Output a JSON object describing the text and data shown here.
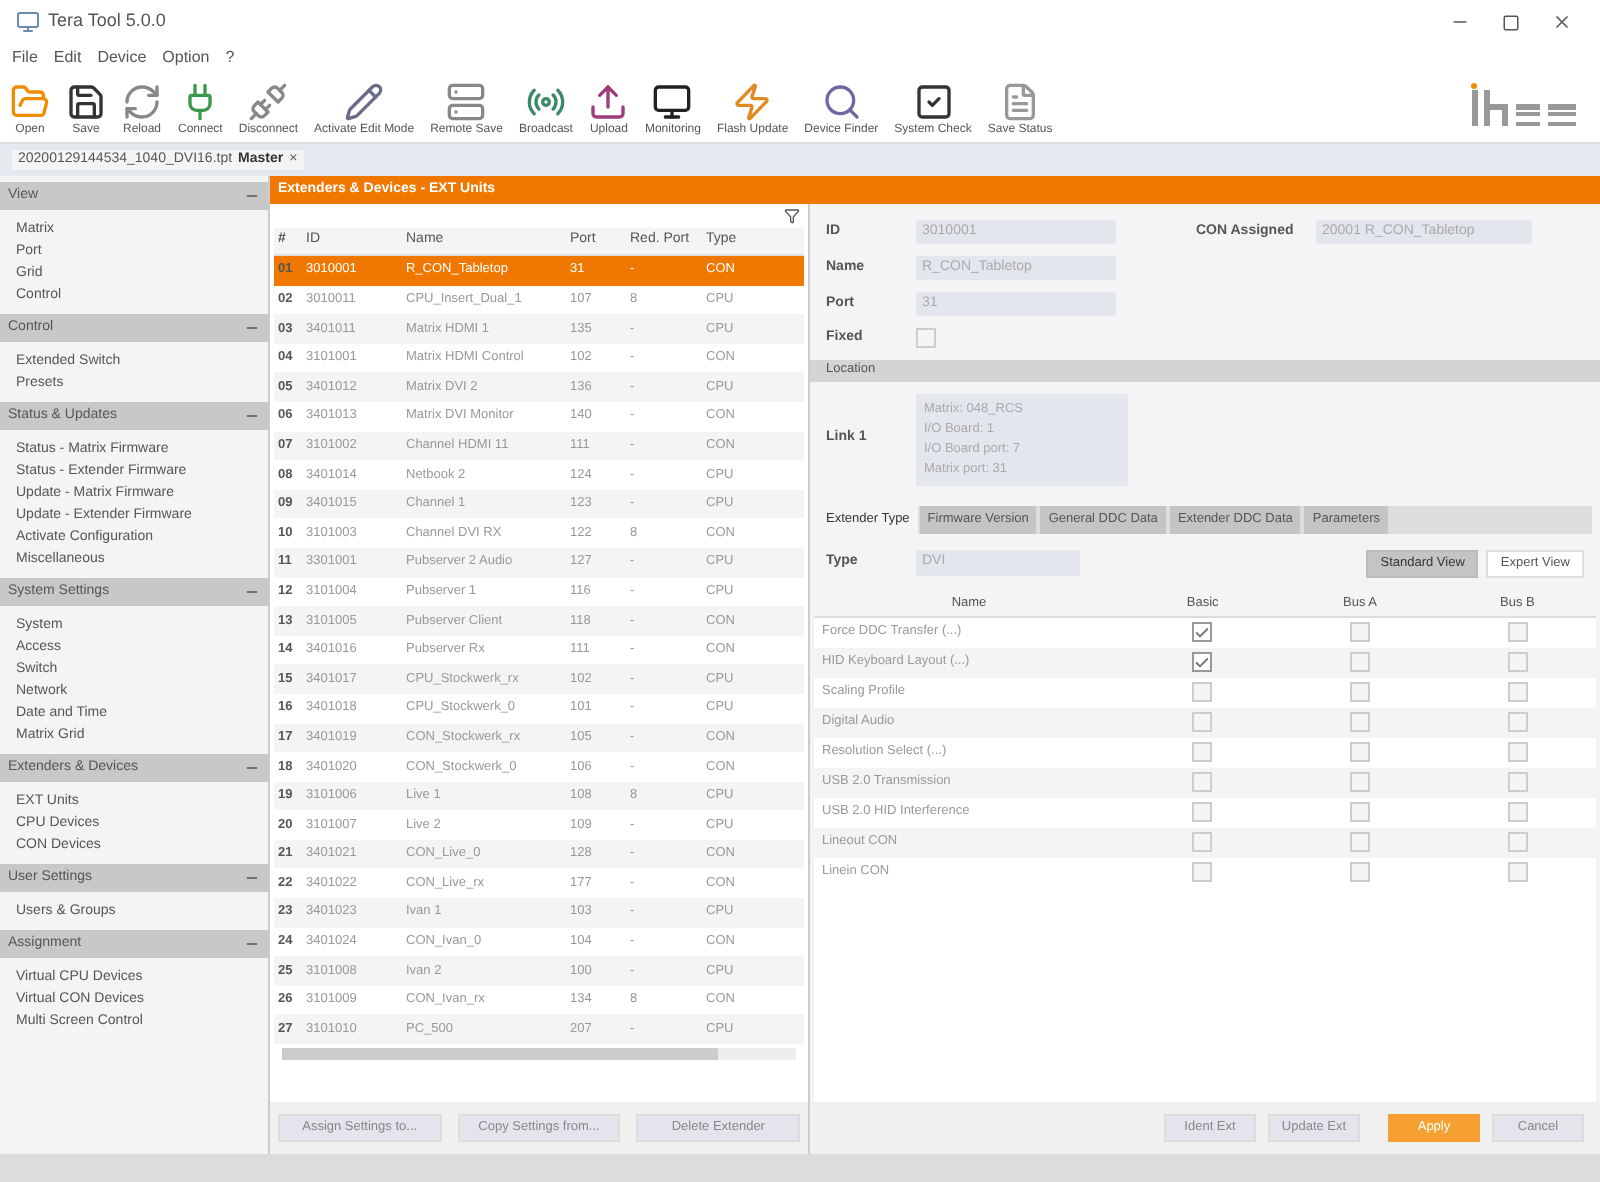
{
  "window": {
    "title": "Tera Tool 5.0.0"
  },
  "menu": [
    "File",
    "Edit",
    "Device",
    "Option",
    "?"
  ],
  "toolbar": [
    {
      "label": "Open",
      "disabled": false
    },
    {
      "label": "Save",
      "disabled": false
    },
    {
      "label": "Reload",
      "disabled": false
    },
    {
      "label": "Connect",
      "disabled": false
    },
    {
      "label": "Disconnect",
      "disabled": false
    },
    {
      "label": "Activate Edit Mode",
      "disabled": false
    },
    {
      "label": "Remote Save",
      "disabled": false
    },
    {
      "label": "Broadcast",
      "disabled": false
    },
    {
      "label": "Upload",
      "disabled": false
    },
    {
      "label": "Monitoring",
      "disabled": false
    },
    {
      "label": "Flash Update",
      "disabled": false
    },
    {
      "label": "Device Finder",
      "disabled": false
    },
    {
      "label": "System Check",
      "disabled": false
    },
    {
      "label": "Save Status",
      "disabled": false
    }
  ],
  "doc_tab": {
    "file": "20200129144534_1040_DVI16.tpt",
    "role": "Master",
    "close": "×"
  },
  "sidebar": [
    {
      "title": "View",
      "expanded": true,
      "items": [
        "Matrix",
        "Port",
        "Grid",
        "Control"
      ]
    },
    {
      "title": "Control",
      "expanded": true,
      "items": [
        "Extended Switch",
        "Presets"
      ]
    },
    {
      "title": "Status & Updates",
      "expanded": true,
      "items": [
        "Status - Matrix Firmware",
        "Status - Extender Firmware",
        "Update - Matrix Firmware",
        "Update - Extender Firmware",
        "Activate Configuration",
        "Miscellaneous"
      ]
    },
    {
      "title": "System Settings",
      "expanded": true,
      "items": [
        "System",
        "Access",
        "Switch",
        "Network",
        "Date and Time",
        "Matrix Grid"
      ]
    },
    {
      "title": "Extenders & Devices",
      "expanded": true,
      "items": [
        "EXT Units",
        "CPU Devices",
        "CON Devices"
      ]
    },
    {
      "title": "User Settings",
      "expanded": true,
      "items": [
        "Users & Groups"
      ]
    },
    {
      "title": "Assignment",
      "expanded": true,
      "items": [
        "Virtual CPU Devices",
        "Virtual CON Devices",
        "Multi Screen Control"
      ]
    }
  ],
  "header": "Extenders & Devices - EXT Units",
  "table": {
    "columns": [
      "#",
      "ID",
      "Name",
      "Port",
      "Red. Port",
      "Type"
    ],
    "rows": [
      {
        "cells": [
          "01",
          "3010001",
          "R_CON_Tabletop",
          "31",
          "-",
          "CON"
        ],
        "selected": true
      },
      {
        "cells": [
          "02",
          "3010011",
          "CPU_Insert_Dual_1",
          "107",
          "8",
          "CPU"
        ],
        "selected": false
      },
      {
        "cells": [
          "03",
          "3401011",
          "Matrix HDMI 1",
          "135",
          "-",
          "CPU"
        ],
        "selected": false
      },
      {
        "cells": [
          "04",
          "3101001",
          "Matrix HDMI Control",
          "102",
          "-",
          "CON"
        ],
        "selected": false
      },
      {
        "cells": [
          "05",
          "3401012",
          "Matrix DVI 2",
          "136",
          "-",
          "CPU"
        ],
        "selected": false
      },
      {
        "cells": [
          "06",
          "3401013",
          "Matrix DVI Monitor",
          "140",
          "-",
          "CON"
        ],
        "selected": false
      },
      {
        "cells": [
          "07",
          "3101002",
          "Channel HDMI 11",
          "111",
          "-",
          "CON"
        ],
        "selected": false
      },
      {
        "cells": [
          "08",
          "3401014",
          "Netbook 2",
          "124",
          "-",
          "CPU"
        ],
        "selected": false
      },
      {
        "cells": [
          "09",
          "3401015",
          "Channel 1",
          "123",
          "-",
          "CPU"
        ],
        "selected": false
      },
      {
        "cells": [
          "10",
          "3101003",
          "Channel DVI RX",
          "122",
          "8",
          "CON"
        ],
        "selected": false
      },
      {
        "cells": [
          "11",
          "3301001",
          "Pubserver 2 Audio",
          "127",
          "-",
          "CPU"
        ],
        "selected": false
      },
      {
        "cells": [
          "12",
          "3101004",
          "Pubserver 1",
          "116",
          "-",
          "CPU"
        ],
        "selected": false
      },
      {
        "cells": [
          "13",
          "3101005",
          "Pubserver Client",
          "118",
          "-",
          "CON"
        ],
        "selected": false
      },
      {
        "cells": [
          "14",
          "3401016",
          "Pubserver Rx",
          "111",
          "-",
          "CON"
        ],
        "selected": false
      },
      {
        "cells": [
          "15",
          "3401017",
          "CPU_Stockwerk_rx",
          "102",
          "-",
          "CPU"
        ],
        "selected": false
      },
      {
        "cells": [
          "16",
          "3401018",
          "CPU_Stockwerk_0",
          "101",
          "-",
          "CPU"
        ],
        "selected": false
      },
      {
        "cells": [
          "17",
          "3401019",
          "CON_Stockwerk_rx",
          "105",
          "-",
          "CON"
        ],
        "selected": false
      },
      {
        "cells": [
          "18",
          "3401020",
          "CON_Stockwerk_0",
          "106",
          "-",
          "CON"
        ],
        "selected": false
      },
      {
        "cells": [
          "19",
          "3101006",
          "Live 1",
          "108",
          "8",
          "CPU"
        ],
        "selected": false
      },
      {
        "cells": [
          "20",
          "3101007",
          "Live 2",
          "109",
          "-",
          "CPU"
        ],
        "selected": false
      },
      {
        "cells": [
          "21",
          "3401021",
          "CON_Live_0",
          "128",
          "-",
          "CON"
        ],
        "selected": false
      },
      {
        "cells": [
          "22",
          "3401022",
          "CON_Live_rx",
          "177",
          "-",
          "CON"
        ],
        "selected": false
      },
      {
        "cells": [
          "23",
          "3401023",
          "Ivan 1",
          "103",
          "-",
          "CPU"
        ],
        "selected": false
      },
      {
        "cells": [
          "24",
          "3401024",
          "CON_Ivan_0",
          "104",
          "-",
          "CON"
        ],
        "selected": false
      },
      {
        "cells": [
          "25",
          "3101008",
          "Ivan 2",
          "100",
          "-",
          "CPU"
        ],
        "selected": false
      },
      {
        "cells": [
          "26",
          "3101009",
          "CON_Ivan_rx",
          "134",
          "8",
          "CON"
        ],
        "selected": false
      },
      {
        "cells": [
          "27",
          "3101010",
          "PC_500",
          "207",
          "-",
          "CPU"
        ],
        "selected": false
      }
    ]
  },
  "table_buttons": [
    "Assign Settings to...",
    "Copy Settings from...",
    "Delete Extender"
  ],
  "details": {
    "id_label": "ID",
    "id": "3010001",
    "con_label": "CON Assigned",
    "con": "20001 R_CON_Tabletop",
    "name_label": "Name",
    "name": "R_CON_Tabletop",
    "port_label": "Port",
    "port": "31",
    "fixed_label": "Fixed",
    "fixed": false,
    "section": "Location",
    "link_label": "Link 1",
    "link_lines": [
      "Matrix: 048_RCS",
      "I/O Board: 1",
      "I/O Board port: 7",
      "Matrix port: 31"
    ]
  },
  "tabs": [
    {
      "label": "Extender Type",
      "selected": true
    },
    {
      "label": "Firmware Version",
      "selected": false
    },
    {
      "label": "General DDC Data",
      "selected": false
    },
    {
      "label": "Extender DDC Data",
      "selected": false
    },
    {
      "label": "Parameters",
      "selected": false
    }
  ],
  "type_label": "Type",
  "type_value": "DVI",
  "views": [
    {
      "label": "Standard View",
      "selected": true
    },
    {
      "label": "Expert View",
      "selected": false
    }
  ],
  "grid": {
    "columns": [
      "Name",
      "Basic",
      "Bus A",
      "Bus B"
    ],
    "rows": [
      {
        "name": "Force DDC Transfer (...)",
        "checks": [
          true,
          false,
          false
        ]
      },
      {
        "name": "HID Keyboard Layout (...)",
        "checks": [
          true,
          false,
          false
        ]
      },
      {
        "name": "Scaling Profile",
        "checks": [
          false,
          false,
          false
        ]
      },
      {
        "name": "Digital Audio",
        "checks": [
          false,
          false,
          false
        ]
      },
      {
        "name": "Resolution Select (...)",
        "checks": [
          false,
          false,
          false
        ]
      },
      {
        "name": "USB 2.0 Transmission",
        "checks": [
          false,
          false,
          false
        ]
      },
      {
        "name": "USB 2.0 HID Interference",
        "checks": [
          false,
          false,
          false
        ]
      },
      {
        "name": "Lineout CON",
        "checks": [
          false,
          false,
          false
        ]
      },
      {
        "name": "Linein CON",
        "checks": [
          false,
          false,
          false
        ]
      }
    ]
  },
  "footer_buttons": [
    {
      "label": "Ident Ext",
      "kind": "plain"
    },
    {
      "label": "Update Ext",
      "kind": "plain"
    },
    {
      "label": "Apply",
      "kind": "primary"
    },
    {
      "label": "Cancel",
      "kind": "plain"
    }
  ]
}
